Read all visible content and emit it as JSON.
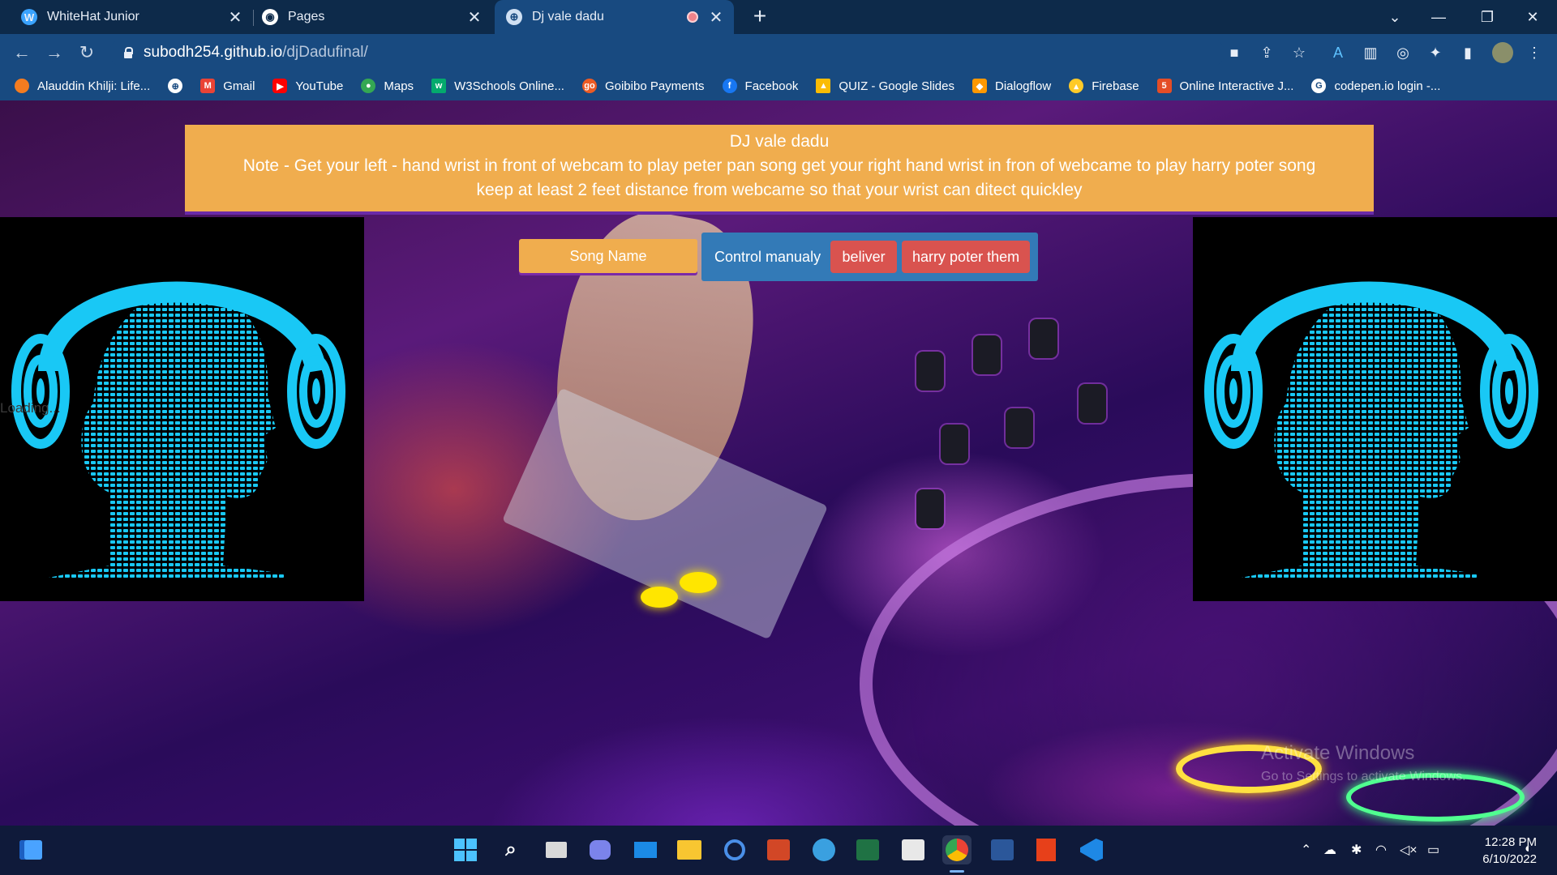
{
  "browser": {
    "tabs": [
      {
        "title": "WhiteHat Junior",
        "favicon": "whitehat-icon",
        "active": false
      },
      {
        "title": "Pages",
        "favicon": "github-icon",
        "active": false
      },
      {
        "title": "Dj vale dadu",
        "favicon": "globe-icon",
        "active": true,
        "recording": true
      }
    ],
    "url_host": "subodh254.github.io",
    "url_path": "/djDadufinal/",
    "bookmarks": [
      {
        "label": "Alauddin Khilji: Life...",
        "color": "#f47c20"
      },
      {
        "label": "",
        "color": "#ffffff"
      },
      {
        "label": "Gmail",
        "color": "#ea4335"
      },
      {
        "label": "YouTube",
        "color": "#ff0000"
      },
      {
        "label": "Maps",
        "color": "#34a853"
      },
      {
        "label": "W3Schools Online...",
        "color": "#04aa6d"
      },
      {
        "label": "Goibibo Payments",
        "color": "#ec5b24"
      },
      {
        "label": "Facebook",
        "color": "#1877f2"
      },
      {
        "label": "QUIZ - Google Slides",
        "color": "#fbbc04"
      },
      {
        "label": "Dialogflow",
        "color": "#ff9800"
      },
      {
        "label": "Firebase",
        "color": "#ffca28"
      },
      {
        "label": "Online Interactive J...",
        "color": "#e44d26"
      },
      {
        "label": "codepen.io login -...",
        "color": "#ffffff"
      }
    ]
  },
  "page": {
    "banner_title": "DJ vale dadu",
    "banner_note": "Note - Get your left - hand wrist in front of webcam to play peter pan song get your right hand wrist in fron of webcame to play harry poter song",
    "banner_note2": "keep at least 2 feet distance from webcame so that your wrist can ditect quickley",
    "loading_text": "Loading...",
    "song_name": "Song Name",
    "control_label": "Control manualy",
    "buttons": {
      "beliver": "beliver",
      "harry": "harry poter them"
    },
    "watermark_title": "Activate Windows",
    "watermark_sub": "Go to Settings to activate Windows."
  },
  "taskbar": {
    "time": "12:28 PM",
    "date": "6/10/2022",
    "apps": [
      "start-icon",
      "search-icon",
      "task-view-icon",
      "teams-chat-icon",
      "mail-icon",
      "file-explorer-icon",
      "cortana-icon",
      "powerpoint-icon",
      "globe-app-icon",
      "excel-icon",
      "store-icon",
      "chrome-icon",
      "word-icon",
      "office-icon",
      "vscode-icon"
    ]
  },
  "colors": {
    "banner": "#f0ad4e",
    "control_box": "#337ab7",
    "danger_button": "#d9534f",
    "headphone_cyan": "#19c8f5"
  }
}
